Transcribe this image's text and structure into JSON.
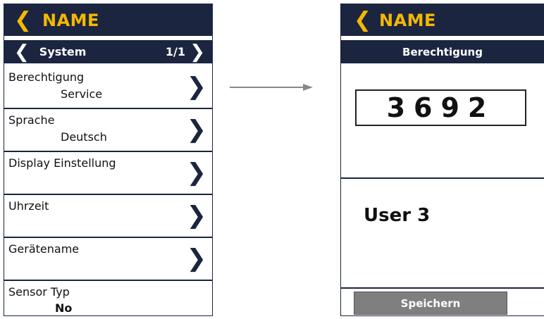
{
  "left_screen": {
    "header_title": "NAME",
    "subheader": {
      "label": "System",
      "page": "1/1"
    },
    "rows": [
      {
        "label": "Berechtigung",
        "value": "Service"
      },
      {
        "label": "Sprache",
        "value": "Deutsch"
      },
      {
        "label": "Display Einstellung",
        "value": ""
      },
      {
        "label": "Uhrzeit",
        "value": ""
      },
      {
        "label": "Gerätename",
        "value": ""
      },
      {
        "label": "Sensor Typ",
        "value": "No"
      }
    ]
  },
  "right_screen": {
    "header_title": "NAME",
    "subheader_label": "Berechtigung",
    "pin": "3692",
    "user_label": "User 3",
    "save_label": "Speichern"
  },
  "icons": {
    "back": "chevron-left-icon",
    "next": "chevron-right-icon",
    "transition": "arrow-right-icon"
  },
  "colors": {
    "header_bg": "#1b2540",
    "accent": "#f5b800",
    "button_bg": "#7f7f7f"
  }
}
